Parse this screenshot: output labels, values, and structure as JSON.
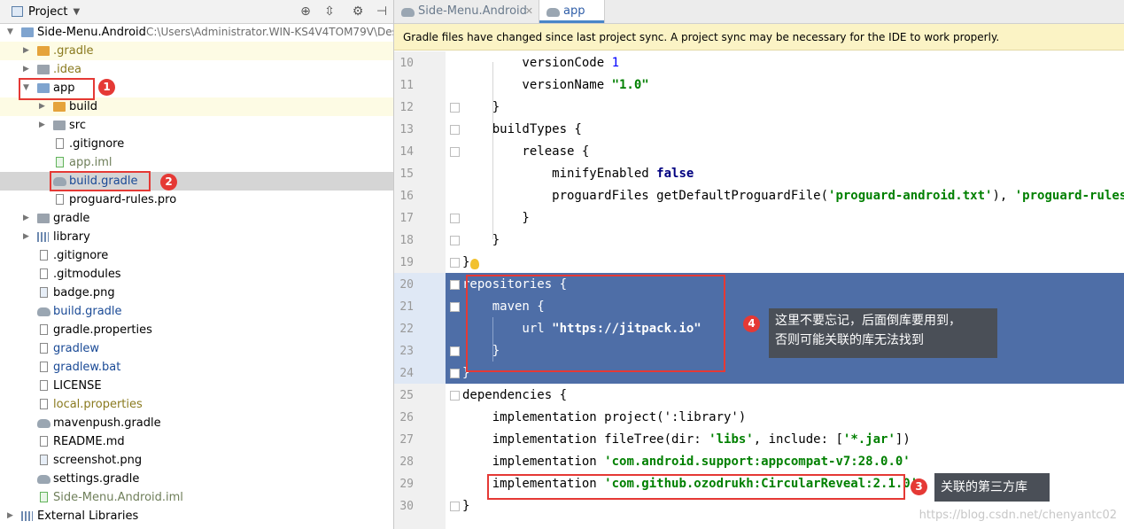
{
  "colors": {
    "accent_red": "#e53935",
    "selection": "#4e6ea7",
    "banner_bg": "#fbf3c5",
    "string_green": "#008000",
    "keyword_navy": "#000080"
  },
  "project_panel": {
    "title": "Project",
    "root": {
      "label": "Side-Menu.Android",
      "path": "C:\\Users\\Administrator.WIN-KS4V4TOM79V\\Des"
    },
    "items": [
      {
        "label": ".gradle",
        "icon": "folder-orange"
      },
      {
        "label": ".idea",
        "icon": "folder"
      },
      {
        "label": "app",
        "icon": "module-folder"
      },
      {
        "label": "build",
        "icon": "folder-orange"
      },
      {
        "label": "src",
        "icon": "folder"
      },
      {
        "label": ".gitignore",
        "icon": "file"
      },
      {
        "label": "app.iml",
        "icon": "iml-file"
      },
      {
        "label": "build.gradle",
        "icon": "gradle-elephant"
      },
      {
        "label": "proguard-rules.pro",
        "icon": "file"
      },
      {
        "label": "gradle",
        "icon": "folder"
      },
      {
        "label": "library",
        "icon": "library-folder"
      },
      {
        "label": ".gitignore",
        "icon": "file"
      },
      {
        "label": ".gitmodules",
        "icon": "file"
      },
      {
        "label": "badge.png",
        "icon": "image-file"
      },
      {
        "label": "build.gradle",
        "icon": "gradle-elephant"
      },
      {
        "label": "gradle.properties",
        "icon": "file"
      },
      {
        "label": "gradlew",
        "icon": "file"
      },
      {
        "label": "gradlew.bat",
        "icon": "file"
      },
      {
        "label": "LICENSE",
        "icon": "file"
      },
      {
        "label": "local.properties",
        "icon": "file"
      },
      {
        "label": "mavenpush.gradle",
        "icon": "gradle-elephant"
      },
      {
        "label": "README.md",
        "icon": "file"
      },
      {
        "label": "screenshot.png",
        "icon": "image-file"
      },
      {
        "label": "settings.gradle",
        "icon": "gradle-elephant"
      },
      {
        "label": "Side-Menu.Android.iml",
        "icon": "iml-file"
      },
      {
        "label": "External Libraries",
        "icon": "library-folder"
      }
    ]
  },
  "annotations": {
    "b1": "1",
    "b2": "2",
    "b3": "3",
    "b4": "4"
  },
  "tooltips": {
    "t4_line1": "这里不要忘记，后面倒库要用到，",
    "t4_line2": "否则可能关联的库无法找到",
    "t3": "关联的第三方库"
  },
  "editor": {
    "tabs": [
      {
        "label": "Side-Menu.Android"
      },
      {
        "label": "app"
      }
    ],
    "banner": "Gradle files have changed since last project sync. A project sync may be necessary for the IDE to work properly.",
    "line_numbers": [
      "10",
      "11",
      "12",
      "13",
      "14",
      "15",
      "16",
      "17",
      "18",
      "19",
      "20",
      "21",
      "22",
      "23",
      "24",
      "25",
      "26",
      "27",
      "28",
      "29",
      "30"
    ],
    "code": {
      "l10a": "        versionCode ",
      "l10b": "1",
      "l11a": "        versionName ",
      "l11b": "\"1.0\"",
      "l12": "    }",
      "l13": "    buildTypes {",
      "l14": "        release {",
      "l15a": "            minifyEnabled ",
      "l15b": "false",
      "l16a": "            proguardFiles getDefaultProguardFile(",
      "l16b": "'proguard-android.txt'",
      "l16c": "), ",
      "l16d": "'proguard-rules.pro'",
      "l17": "        }",
      "l18": "    }",
      "l19": "}",
      "l20": "repositories {",
      "l21": "    maven {",
      "l22a": "        url ",
      "l22b": "\"https://jitpack.io\"",
      "l23": "    }",
      "l24": "}",
      "l25": "dependencies {",
      "l26": "    implementation project(':library')",
      "l27a": "    implementation fileTree(dir: ",
      "l27b": "'libs'",
      "l27c": ", include: [",
      "l27d": "'*.jar'",
      "l27e": "])",
      "l28a": "    implementation ",
      "l28b": "'com.android.support:appcompat-v7:28.0.0'",
      "l29a": "    implementation ",
      "l29b": "'com.github.ozodrukh:CircularReveal:2.1.0'",
      "l30": "}"
    }
  },
  "watermark": "https://blog.csdn.net/chenyantc02"
}
